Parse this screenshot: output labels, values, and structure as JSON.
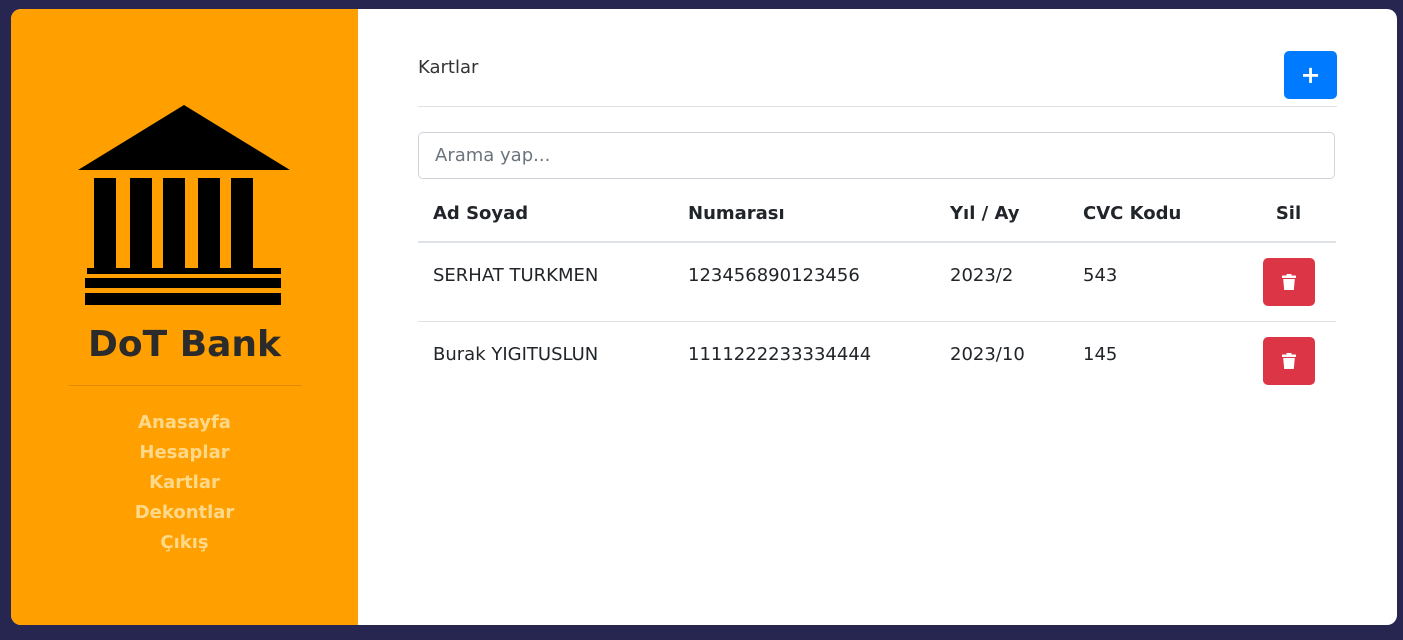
{
  "sidebar": {
    "bank_name": "DoT Bank",
    "nav": [
      {
        "label": "Anasayfa"
      },
      {
        "label": "Hesaplar"
      },
      {
        "label": "Kartlar"
      },
      {
        "label": "Dekontlar"
      },
      {
        "label": "Çıkış"
      }
    ],
    "logo_icon": "bank-building-icon",
    "background_color": "#ff9f00",
    "nav_color": "#ffd98a"
  },
  "main": {
    "title": "Kartlar",
    "add_button_label": "+",
    "search": {
      "placeholder": "Arama yap...",
      "value": ""
    },
    "table": {
      "headers": [
        "Ad Soyad",
        "Numarası",
        "Yıl / Ay",
        "CVC Kodu",
        "Sil"
      ],
      "rows": [
        {
          "name": "SERHAT TURKMEN",
          "number": "123456890123456",
          "date": "2023/2",
          "cvc": "543"
        },
        {
          "name": "Burak YIGITUSLUN",
          "number": "1111222233334444",
          "date": "2023/10",
          "cvc": "145"
        }
      ]
    },
    "delete_icon": "trash-icon",
    "colors": {
      "primary": "#007bff",
      "danger": "#dc3545"
    }
  }
}
